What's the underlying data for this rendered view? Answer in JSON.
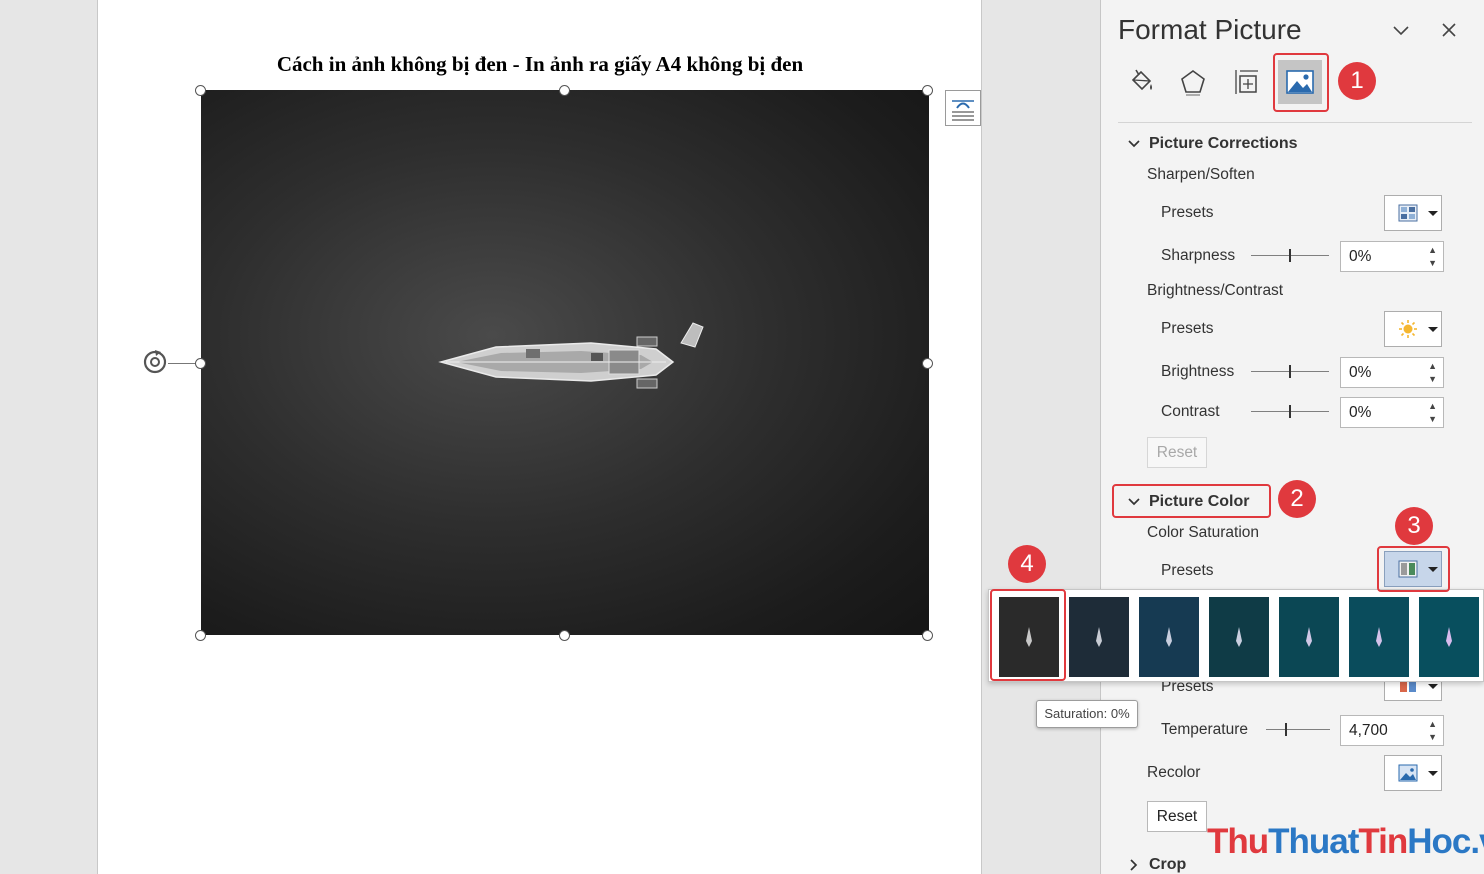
{
  "document": {
    "title": "Cách in ảnh không bị đen - In ảnh ra giấy A4 không bị đen"
  },
  "pane": {
    "title": "Format Picture",
    "tabs": [
      {
        "name": "fill-line",
        "icon": "paint-bucket-icon"
      },
      {
        "name": "effects",
        "icon": "pentagon-icon"
      },
      {
        "name": "size-properties",
        "icon": "size-position-icon"
      },
      {
        "name": "picture",
        "icon": "picture-icon",
        "active": true
      }
    ],
    "corrections": {
      "header": "Picture Corrections",
      "sharpen_soften": "Sharpen/Soften",
      "presets_label": "Presets",
      "sharpness_label": "Sharpness",
      "sharpness_value": "0%",
      "brightness_contrast": "Brightness/Contrast",
      "presets2_label": "Presets",
      "brightness_label": "Brightness",
      "brightness_value": "0%",
      "contrast_label": "Contrast",
      "contrast_value": "0%",
      "reset_label": "Reset"
    },
    "color": {
      "header": "Picture Color",
      "saturation_label": "Color Saturation",
      "presets_label": "Presets",
      "tone_presets_label": "Presets",
      "temperature_label": "Temperature",
      "temperature_value": "4,700",
      "recolor_label": "Recolor",
      "reset_label": "Reset"
    },
    "crop": {
      "header": "Crop"
    }
  },
  "gallery": {
    "tooltip": "Saturation: 0%",
    "swatches": [
      {
        "color": "#2a2a2a"
      },
      {
        "color": "#1e2c38"
      },
      {
        "color": "#163a52"
      },
      {
        "color": "#0f3b46"
      },
      {
        "color": "#0b4754"
      },
      {
        "color": "#0a4c5c"
      },
      {
        "color": "#084f5e"
      }
    ]
  },
  "annotations": [
    "1",
    "2",
    "3",
    "4"
  ],
  "watermark": {
    "part1": "Thu",
    "part2": "Thuat",
    "part3": "Tin",
    "part4": "Hoc",
    "part5": ".vn",
    "colors": [
      "#e0393e",
      "#2b78c5"
    ]
  }
}
